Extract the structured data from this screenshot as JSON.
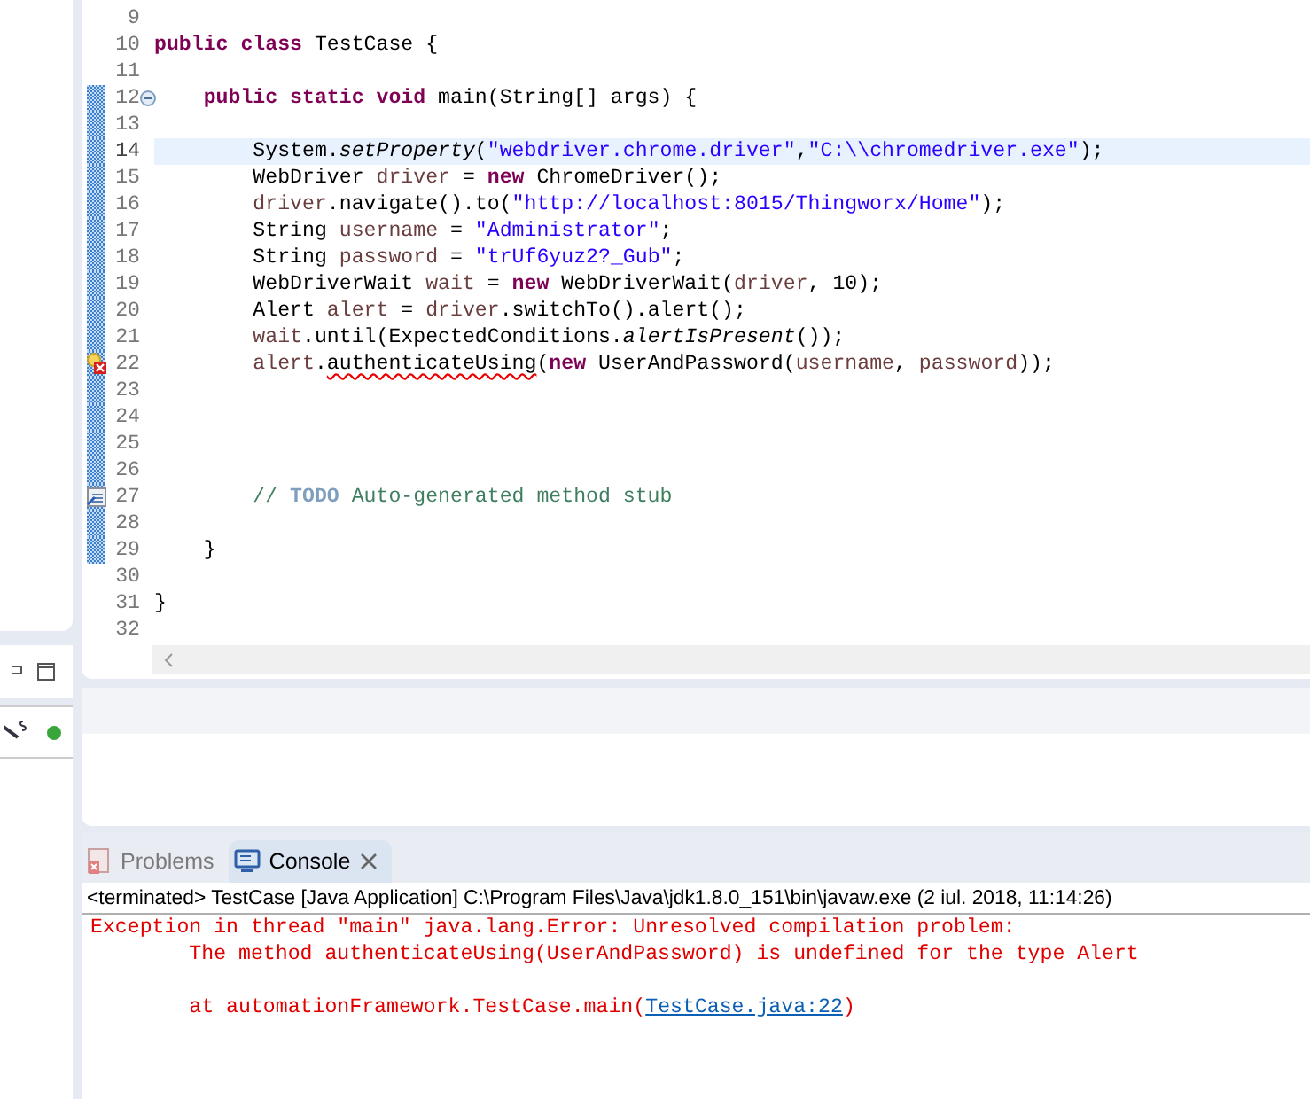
{
  "editor": {
    "lines": [
      {
        "number": "9",
        "changed": false,
        "current": false
      },
      {
        "number": "10",
        "changed": false,
        "current": false,
        "tokens": [
          {
            "kind": "keyword",
            "text": "public class "
          },
          {
            "kind": "text",
            "text": "TestCase {"
          }
        ]
      },
      {
        "number": "11",
        "changed": false,
        "current": false
      },
      {
        "number": "12",
        "changed": true,
        "current": false,
        "foldable": true,
        "tokens": [
          {
            "kind": "keyword",
            "text": "    public static void "
          },
          {
            "kind": "text",
            "text": "main(String[] args) {"
          }
        ]
      },
      {
        "number": "13",
        "changed": true,
        "current": false
      },
      {
        "number": "14",
        "changed": true,
        "current": true,
        "tokens": [
          {
            "kind": "text",
            "text": "        System."
          },
          {
            "kind": "static",
            "text": "setProperty"
          },
          {
            "kind": "text",
            "text": "("
          },
          {
            "kind": "string",
            "text": "\"webdriver.chrome.driver\""
          },
          {
            "kind": "text",
            "text": ","
          },
          {
            "kind": "string",
            "text": "\"C:\\\\chromedriver.exe\""
          },
          {
            "kind": "text",
            "text": ");"
          }
        ]
      },
      {
        "number": "15",
        "changed": true,
        "current": false,
        "tokens": [
          {
            "kind": "text",
            "text": "        WebDriver "
          },
          {
            "kind": "variable",
            "text": "driver"
          },
          {
            "kind": "text",
            "text": " = "
          },
          {
            "kind": "keyword",
            "text": "new"
          },
          {
            "kind": "text",
            "text": " ChromeDriver();"
          }
        ]
      },
      {
        "number": "16",
        "changed": true,
        "current": false,
        "tokens": [
          {
            "kind": "variable",
            "text": "        driver"
          },
          {
            "kind": "text",
            "text": ".navigate().to("
          },
          {
            "kind": "string",
            "text": "\"http://localhost:8015/Thingworx/Home\""
          },
          {
            "kind": "text",
            "text": ");"
          }
        ]
      },
      {
        "number": "17",
        "changed": true,
        "current": false,
        "tokens": [
          {
            "kind": "text",
            "text": "        String "
          },
          {
            "kind": "variable",
            "text": "username"
          },
          {
            "kind": "text",
            "text": " = "
          },
          {
            "kind": "string",
            "text": "\"Administrator\""
          },
          {
            "kind": "text",
            "text": ";"
          }
        ]
      },
      {
        "number": "18",
        "changed": true,
        "current": false,
        "tokens": [
          {
            "kind": "text",
            "text": "        String "
          },
          {
            "kind": "variable",
            "text": "password"
          },
          {
            "kind": "text",
            "text": " = "
          },
          {
            "kind": "string",
            "text": "\"trUf6yuz2?_Gub\""
          },
          {
            "kind": "text",
            "text": ";"
          }
        ]
      },
      {
        "number": "19",
        "changed": true,
        "current": false,
        "tokens": [
          {
            "kind": "text",
            "text": "        WebDriverWait "
          },
          {
            "kind": "variable",
            "text": "wait"
          },
          {
            "kind": "text",
            "text": " = "
          },
          {
            "kind": "keyword",
            "text": "new"
          },
          {
            "kind": "text",
            "text": " WebDriverWait("
          },
          {
            "kind": "variable",
            "text": "driver"
          },
          {
            "kind": "text",
            "text": ", 10);"
          }
        ]
      },
      {
        "number": "20",
        "changed": true,
        "current": false,
        "tokens": [
          {
            "kind": "text",
            "text": "        Alert "
          },
          {
            "kind": "variable",
            "text": "alert"
          },
          {
            "kind": "text",
            "text": " = "
          },
          {
            "kind": "variable",
            "text": "driver"
          },
          {
            "kind": "text",
            "text": ".switchTo().alert();"
          }
        ]
      },
      {
        "number": "21",
        "changed": true,
        "current": false,
        "tokens": [
          {
            "kind": "variable",
            "text": "        wait"
          },
          {
            "kind": "text",
            "text": ".until(ExpectedConditions."
          },
          {
            "kind": "static",
            "text": "alertIsPresent"
          },
          {
            "kind": "text",
            "text": "());"
          }
        ]
      },
      {
        "number": "22",
        "changed": true,
        "current": false,
        "error": true,
        "tokens": [
          {
            "kind": "variable",
            "text": "        alert"
          },
          {
            "kind": "text",
            "text": "."
          },
          {
            "kind": "error",
            "text": "authenticateUsing"
          },
          {
            "kind": "text",
            "text": "("
          },
          {
            "kind": "keyword",
            "text": "new"
          },
          {
            "kind": "text",
            "text": " UserAndPassword("
          },
          {
            "kind": "variable",
            "text": "username"
          },
          {
            "kind": "text",
            "text": ", "
          },
          {
            "kind": "variable",
            "text": "password"
          },
          {
            "kind": "text",
            "text": "));"
          }
        ]
      },
      {
        "number": "23",
        "changed": true,
        "current": false
      },
      {
        "number": "24",
        "changed": true,
        "current": false
      },
      {
        "number": "25",
        "changed": true,
        "current": false
      },
      {
        "number": "26",
        "changed": true,
        "current": false
      },
      {
        "number": "27",
        "changed": true,
        "current": false,
        "task": true,
        "tokens": [
          {
            "kind": "comment",
            "text": "        // "
          },
          {
            "kind": "todo",
            "text": "TODO"
          },
          {
            "kind": "comment",
            "text": " Auto-generated method stub"
          }
        ]
      },
      {
        "number": "28",
        "changed": true,
        "current": false
      },
      {
        "number": "29",
        "changed": true,
        "current": false,
        "tokens": [
          {
            "kind": "text",
            "text": "    }"
          }
        ]
      },
      {
        "number": "30",
        "changed": false,
        "current": false
      },
      {
        "number": "31",
        "changed": false,
        "current": false,
        "tokens": [
          {
            "kind": "text",
            "text": "}"
          }
        ]
      },
      {
        "number": "32",
        "changed": false,
        "current": false
      }
    ]
  },
  "console_view": {
    "tabs": [
      {
        "label": "Problems",
        "kind": "problems",
        "selected": false
      },
      {
        "label": "Console",
        "kind": "console",
        "selected": true
      }
    ],
    "header": "<terminated> TestCase [Java Application] C:\\Program Files\\Java\\jdk1.8.0_151\\bin\\javaw.exe (2 iul. 2018, 11:14:26)",
    "lines": [
      {
        "segments": [
          {
            "kind": "error",
            "text": "Exception in thread \"main\" java.lang.Error: Unresolved compilation problem: "
          }
        ]
      },
      {
        "segments": [
          {
            "kind": "error",
            "text": "\tThe method authenticateUsing(UserAndPassword) is undefined for the type Alert"
          }
        ]
      },
      {
        "gap_before": true,
        "segments": [
          {
            "kind": "error",
            "text": "\tat automationFramework.TestCase.main("
          },
          {
            "kind": "link",
            "text": "TestCase.java:22"
          },
          {
            "kind": "error",
            "text": ")"
          }
        ]
      }
    ]
  }
}
